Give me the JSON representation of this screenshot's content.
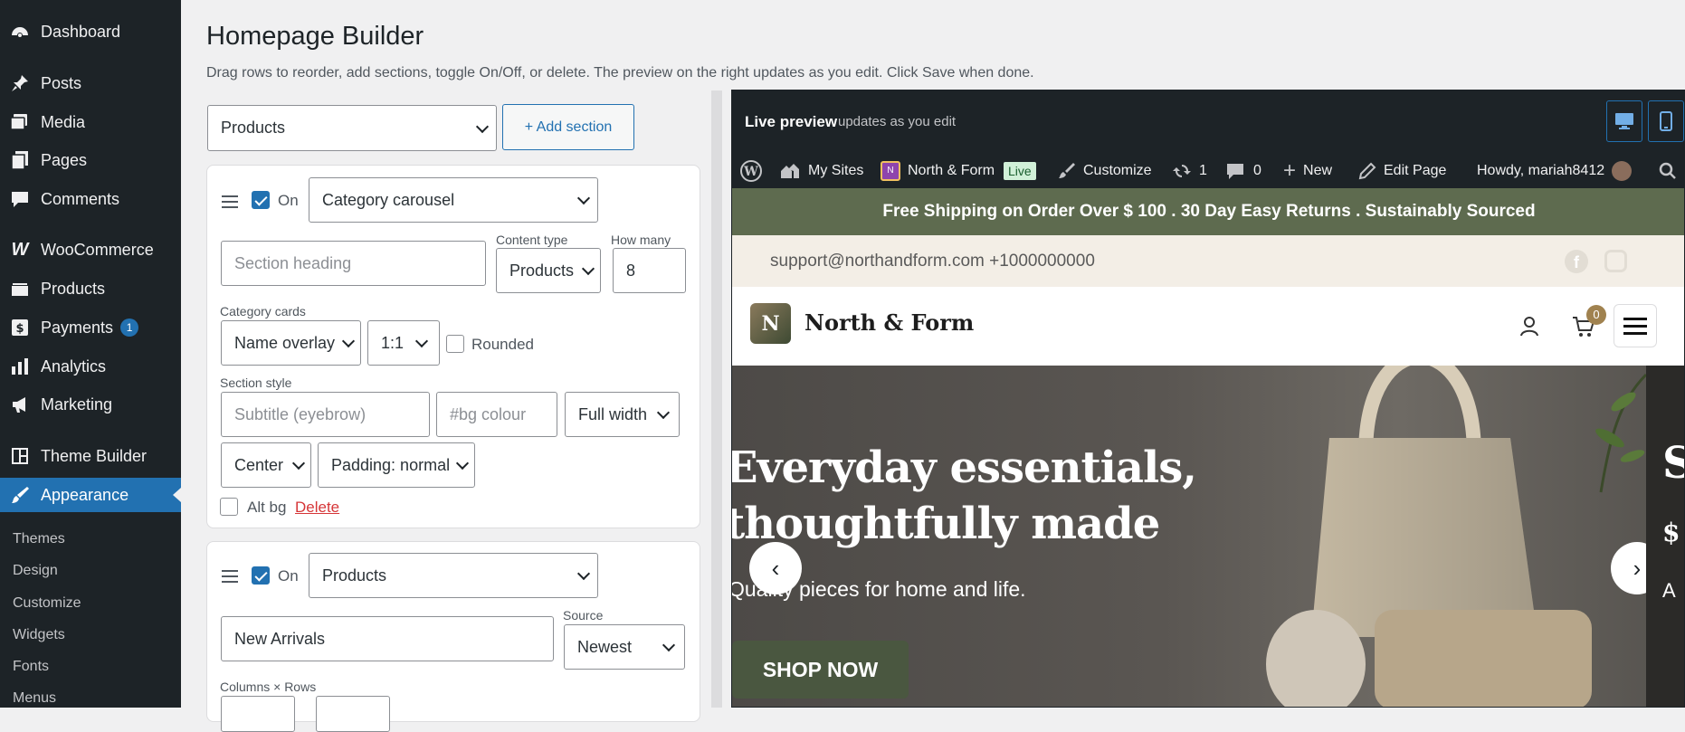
{
  "sidebar": {
    "items": [
      {
        "label": "Dashboard",
        "icon": "dashboard-icon"
      },
      {
        "label": "Posts",
        "icon": "pin-icon"
      },
      {
        "label": "Media",
        "icon": "media-icon"
      },
      {
        "label": "Pages",
        "icon": "pages-icon"
      },
      {
        "label": "Comments",
        "icon": "comment-icon"
      },
      {
        "label": "WooCommerce",
        "icon": "woo-icon"
      },
      {
        "label": "Products",
        "icon": "products-icon"
      },
      {
        "label": "Payments",
        "icon": "payments-icon",
        "badge": "1"
      },
      {
        "label": "Analytics",
        "icon": "analytics-icon"
      },
      {
        "label": "Marketing",
        "icon": "megaphone-icon"
      },
      {
        "label": "Theme Builder",
        "icon": "theme-builder-icon"
      },
      {
        "label": "Appearance",
        "icon": "brush-icon"
      }
    ],
    "submenu": [
      "Themes",
      "Design",
      "Customize",
      "Widgets",
      "Fonts",
      "Menus"
    ]
  },
  "header": {
    "title": "Homepage Builder",
    "description": "Drag rows to reorder, add sections, toggle On/Off, or delete. The preview on the right updates as you edit. Click Save when done."
  },
  "toolbar": {
    "section_select": "Products",
    "add_label": "+ Add section"
  },
  "section1": {
    "on_label": "On",
    "type": "Category carousel",
    "heading_placeholder": "Section heading",
    "content_type_label": "Content type",
    "content_type": "Products",
    "how_many_label": "How many",
    "how_many": "8",
    "cards_label": "Category cards",
    "overlay": "Name overlay",
    "ratio": "1:1",
    "rounded_label": "Rounded",
    "style_label": "Section style",
    "subtitle_placeholder": "Subtitle (eyebrow)",
    "bg_placeholder": "#bg colour",
    "width": "Full width",
    "align": "Center",
    "padding": "Padding: normal",
    "alt_bg_label": "Alt bg",
    "delete_label": "Delete"
  },
  "section2": {
    "on_label": "On",
    "type": "Products",
    "heading": "New Arrivals",
    "source_label": "Source",
    "source": "Newest",
    "columns_label": "Columns × Rows"
  },
  "preview": {
    "title": "Live preview",
    "subtitle": "updates as you edit",
    "adminbar": {
      "my_sites": "My Sites",
      "site_name": "North & Form",
      "live": "Live",
      "customize": "Customize",
      "updates": "1",
      "comments": "0",
      "new": "New",
      "edit_page": "Edit Page",
      "howdy": "Howdy, mariah8412"
    },
    "shipping_banner": "Free Shipping on Order Over $ 100 . 30 Day Easy Returns . Sustainably Sourced",
    "contact": "support@northandform.com +1000000000",
    "logo_letter": "N",
    "site_title": "North & Form",
    "cart_count": "0",
    "hero": {
      "title": "Everyday essentials, thoughtfully made",
      "subtitle": "Quality pieces for home and life.",
      "cta": "SHOP NOW",
      "prev": "‹",
      "next": "›",
      "next_slide_title": "S",
      "next_slide_price": "$",
      "next_slide_sub": "A"
    }
  }
}
